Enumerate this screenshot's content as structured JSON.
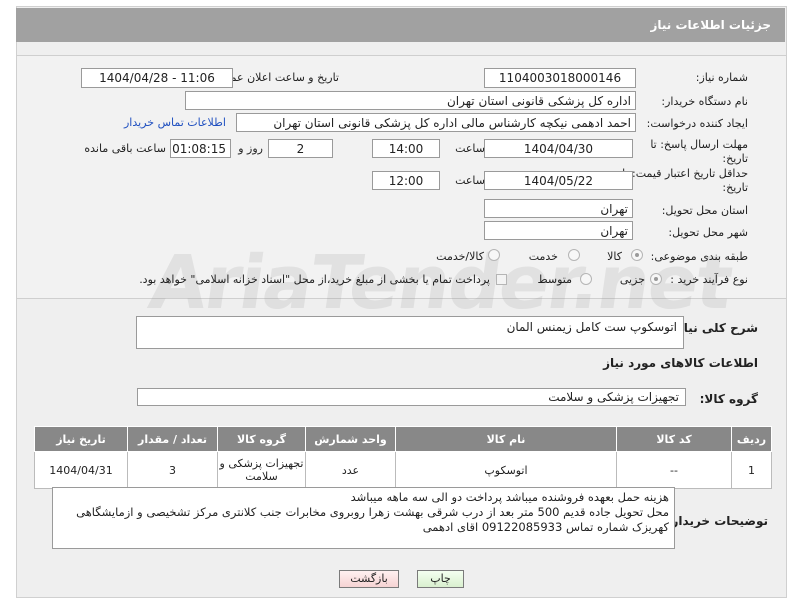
{
  "header": {
    "title": "جزئیات اطلاعات نیاز"
  },
  "form": {
    "need_number_label": "شماره نیاز:",
    "need_number": "1104003018000146",
    "announce_label": "تاریخ و ساعت اعلان عمومی:",
    "announce_value": "1404/04/28 - 11:06",
    "buyer_org_label": "نام دستگاه خریدار:",
    "buyer_org": "اداره کل پزشکی قانونی استان تهران",
    "requester_label": "ایجاد کننده درخواست:",
    "requester": "احمد ادهمی نیکچه کارشناس مالی اداره کل پزشکی قانونی استان تهران",
    "contact_link": "اطلاعات تماس خریدار",
    "reply_deadline_label": "مهلت ارسال پاسخ: تا تاریخ:",
    "reply_date": "1404/04/30",
    "time_label": "ساعت",
    "reply_time": "14:00",
    "days": "2",
    "days_label": "روز و",
    "remaining_time": "01:08:15",
    "remaining_label": "ساعت باقی مانده",
    "price_validity_label": "حداقل تاریخ اعتبار قیمت: تا تاریخ:",
    "validity_date": "1404/05/22",
    "validity_time": "12:00",
    "province_label": "استان محل تحویل:",
    "province": "تهران",
    "city_label": "شهر محل تحویل:",
    "city": "تهران",
    "category_label": "طبقه بندی موضوعی:",
    "category_goods": "کالا",
    "category_service": "خدمت",
    "category_both": "کالا/خدمت",
    "process_label": "نوع فرآیند خرید :",
    "process_minor": "جزیی",
    "process_medium": "متوسط",
    "payment_note": "پرداخت تمام یا بخشی از مبلغ خرید،از محل \"اسناد خزانه اسلامی\" خواهد بود."
  },
  "summary": {
    "label": "شرح کلی نیاز:",
    "text": "اتوسکوپ ست کامل زیمنس المان"
  },
  "goods_section_title": "اطلاعات کالاهای مورد نیاز",
  "goods_group": {
    "label": "گروه کالا:",
    "value": "تجهیزات پزشکی و سلامت"
  },
  "table": {
    "headers": [
      "ردیف",
      "کد کالا",
      "نام کالا",
      "واحد شمارش",
      "گروه کالا",
      "تعداد / مقدار",
      "تاریخ نیاز"
    ],
    "rows": [
      [
        "1",
        "--",
        "اتوسکوپ",
        "عدد",
        "تجهیزات پزشکی و سلامت",
        "3",
        "1404/04/31"
      ]
    ]
  },
  "buyer_notes": {
    "label": "توضیحات خریدار:",
    "line1": "هزینه حمل بعهده فروشنده میباشد پرداخت دو الی سه ماهه میباشد",
    "line2": "محل تحویل جاده قدیم 500 متر بعد از درب شرقی بهشت زهرا روبروی مخابرات جنب کلانتری مرکز تشخیصی و ازمایشگاهی",
    "line3": "کهریزک شماره تماس 09122085933 اقای ادهمی"
  },
  "buttons": {
    "print": "چاپ",
    "back": "بازگشت"
  },
  "watermark": "AriaTender.net"
}
